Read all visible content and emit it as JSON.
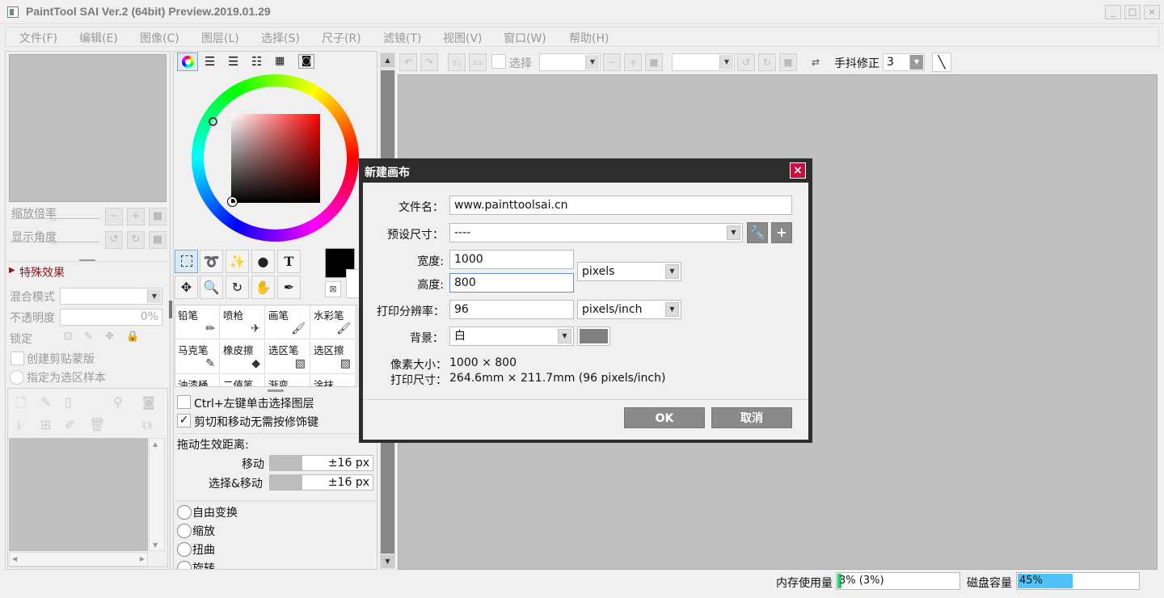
{
  "app": {
    "title": "PaintTool SAI Ver.2 (64bit) Preview.2019.01.29"
  },
  "window_buttons": {
    "minimize": "_",
    "maximize": "□",
    "close": "×"
  },
  "menu": [
    "文件(F)",
    "编辑(E)",
    "图像(C)",
    "图层(L)",
    "选择(S)",
    "尺子(R)",
    "滤镜(T)",
    "视图(V)",
    "窗口(W)",
    "帮助(H)"
  ],
  "navigator": {
    "zoom_label": "缩放倍率",
    "rotation_label": "显示角度"
  },
  "layer_panel": {
    "effects_label": "特殊效果",
    "blend_mode_label": "混合模式",
    "opacity_label": "不透明度",
    "opacity_value": "0%",
    "lock_label": "锁定",
    "clipping_label": "创建剪贴蒙版",
    "selection_source_label": "指定为选区样本"
  },
  "color_panel": {
    "main_color": "#000000",
    "hue_accent": "#ff0000"
  },
  "tools": {
    "text_tool": "T"
  },
  "brushes": [
    {
      "name": "铅笔",
      "icon": "pencil-icon"
    },
    {
      "name": "喷枪",
      "icon": "airbrush-icon"
    },
    {
      "name": "画笔",
      "icon": "brush-icon"
    },
    {
      "name": "水彩笔",
      "icon": "watercolor-icon"
    },
    {
      "name": "马克笔",
      "icon": "marker-icon"
    },
    {
      "name": "橡皮擦",
      "icon": "eraser-icon"
    },
    {
      "name": "选区笔",
      "icon": "selpen-icon"
    },
    {
      "name": "选区擦",
      "icon": "selerase-icon"
    },
    {
      "name": "油漆桶",
      "icon": "bucket-icon"
    },
    {
      "name": "二值笔",
      "icon": "binary-icon"
    },
    {
      "name": "渐变",
      "icon": "gradient-icon"
    },
    {
      "name": "涂抹",
      "icon": "smudge-icon"
    }
  ],
  "tool_options": {
    "ctrl_click_label": "Ctrl+左键单击选择图层",
    "ctrl_click_checked": false,
    "cut_move_label": "剪切和移动无需按修饰键",
    "cut_move_checked": true,
    "drag_distance_label": "拖动生效距离:",
    "move_label": "移动",
    "move_value": "±16 px",
    "select_move_label": "选择&移动",
    "select_move_value": "±16 px",
    "transform_options": [
      "自由变换",
      "缩放",
      "扭曲",
      "旋转"
    ]
  },
  "top_toolbar": {
    "selection_label": "选择",
    "stabilizer_label": "手抖修正",
    "stabilizer_value": "3"
  },
  "dialog": {
    "title": "新建画布",
    "filename_label": "文件名：",
    "filename_value": "www.painttoolsai.cn",
    "preset_label": "预设尺寸：",
    "preset_value": "----",
    "width_label": "宽度:",
    "width_value": "1000",
    "height_label": "高度:",
    "height_value": "800",
    "unit_value": "pixels",
    "dpi_label": "打印分辨率：",
    "dpi_value": "96",
    "dpi_unit_value": "pixels/inch",
    "bg_label": "背景：",
    "bg_value": "白",
    "bg_swatch_color": "#808080",
    "pixel_size_label": "像素大小：",
    "pixel_size_value": "1000 × 800",
    "print_size_label": "打印尺寸：",
    "print_size_value": "264.6mm × 211.7mm (96 pixels/inch)",
    "ok_label": "OK",
    "cancel_label": "取消"
  },
  "status": {
    "memory_label": "内存使用量",
    "memory_value": "3% (3%)",
    "memory_fraction": 0.03,
    "disk_label": "磁盘容量",
    "disk_value": "45%",
    "disk_fraction": 0.45,
    "disk_color": "#4fc3f7",
    "memory_color": "#2ecc71"
  }
}
